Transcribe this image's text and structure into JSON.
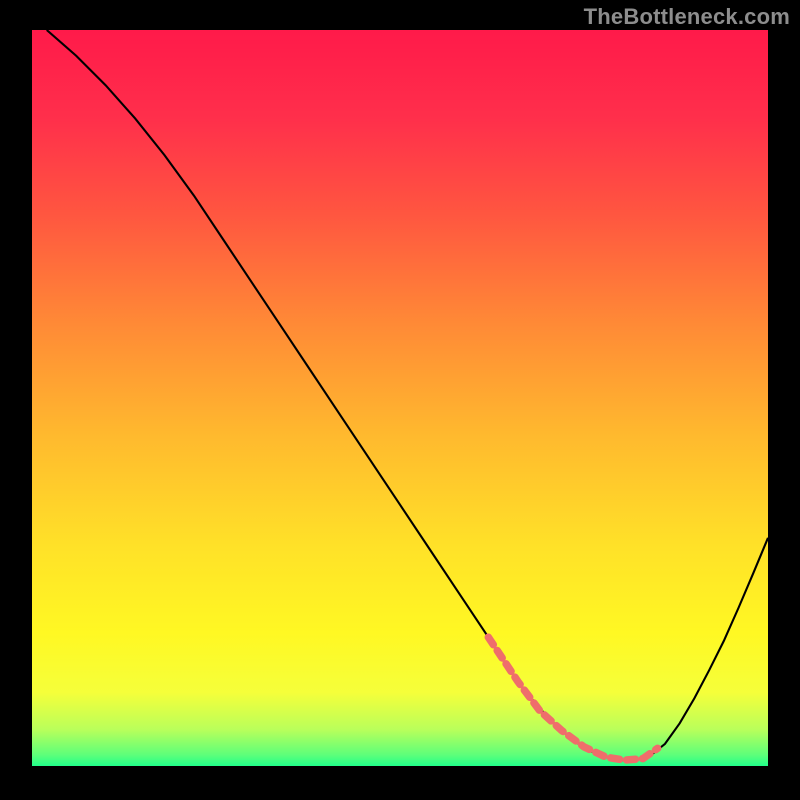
{
  "watermark": "TheBottleneck.com",
  "gradient": {
    "stops": [
      {
        "offset": 0.0,
        "color": "#ff1a4a"
      },
      {
        "offset": 0.12,
        "color": "#ff2f4b"
      },
      {
        "offset": 0.25,
        "color": "#ff5640"
      },
      {
        "offset": 0.4,
        "color": "#ff8a36"
      },
      {
        "offset": 0.55,
        "color": "#ffb92e"
      },
      {
        "offset": 0.7,
        "color": "#ffe128"
      },
      {
        "offset": 0.82,
        "color": "#fff823"
      },
      {
        "offset": 0.9,
        "color": "#f5ff3a"
      },
      {
        "offset": 0.95,
        "color": "#baff5a"
      },
      {
        "offset": 0.985,
        "color": "#5dff7a"
      },
      {
        "offset": 1.0,
        "color": "#22ff8a"
      }
    ]
  },
  "chart_data": {
    "type": "line",
    "title": "",
    "xlabel": "",
    "ylabel": "",
    "xlim": [
      0,
      100
    ],
    "ylim": [
      0,
      100
    ],
    "series": [
      {
        "name": "curve",
        "stroke": "#000000",
        "stroke_width": 2.1,
        "x": [
          2,
          6,
          10,
          14,
          18,
          22,
          26,
          30,
          34,
          38,
          42,
          46,
          50,
          54,
          58,
          62,
          66,
          68,
          70,
          72,
          74,
          76,
          78,
          80,
          82,
          84,
          86,
          88,
          90,
          92,
          94,
          96,
          98,
          100
        ],
        "y": [
          100,
          96.5,
          92.5,
          88,
          83,
          77.5,
          71.5,
          65.5,
          59.5,
          53.5,
          47.5,
          41.5,
          35.5,
          29.5,
          23.5,
          17.5,
          11.5,
          9,
          6.7,
          4.8,
          3.2,
          2.0,
          1.2,
          0.8,
          0.8,
          1.4,
          3.0,
          5.8,
          9.2,
          13.0,
          17.0,
          21.5,
          26.2,
          31.0
        ]
      },
      {
        "name": "marker-band",
        "stroke": "#ef6e6b",
        "stroke_width": 7.5,
        "dash": "9 7",
        "linecap": "round",
        "x": [
          62,
          66,
          69,
          72,
          75,
          78,
          80.5,
          83,
          85
        ],
        "y": [
          17.5,
          11.5,
          7.5,
          4.8,
          2.6,
          1.2,
          0.8,
          1.0,
          2.4
        ]
      }
    ]
  }
}
